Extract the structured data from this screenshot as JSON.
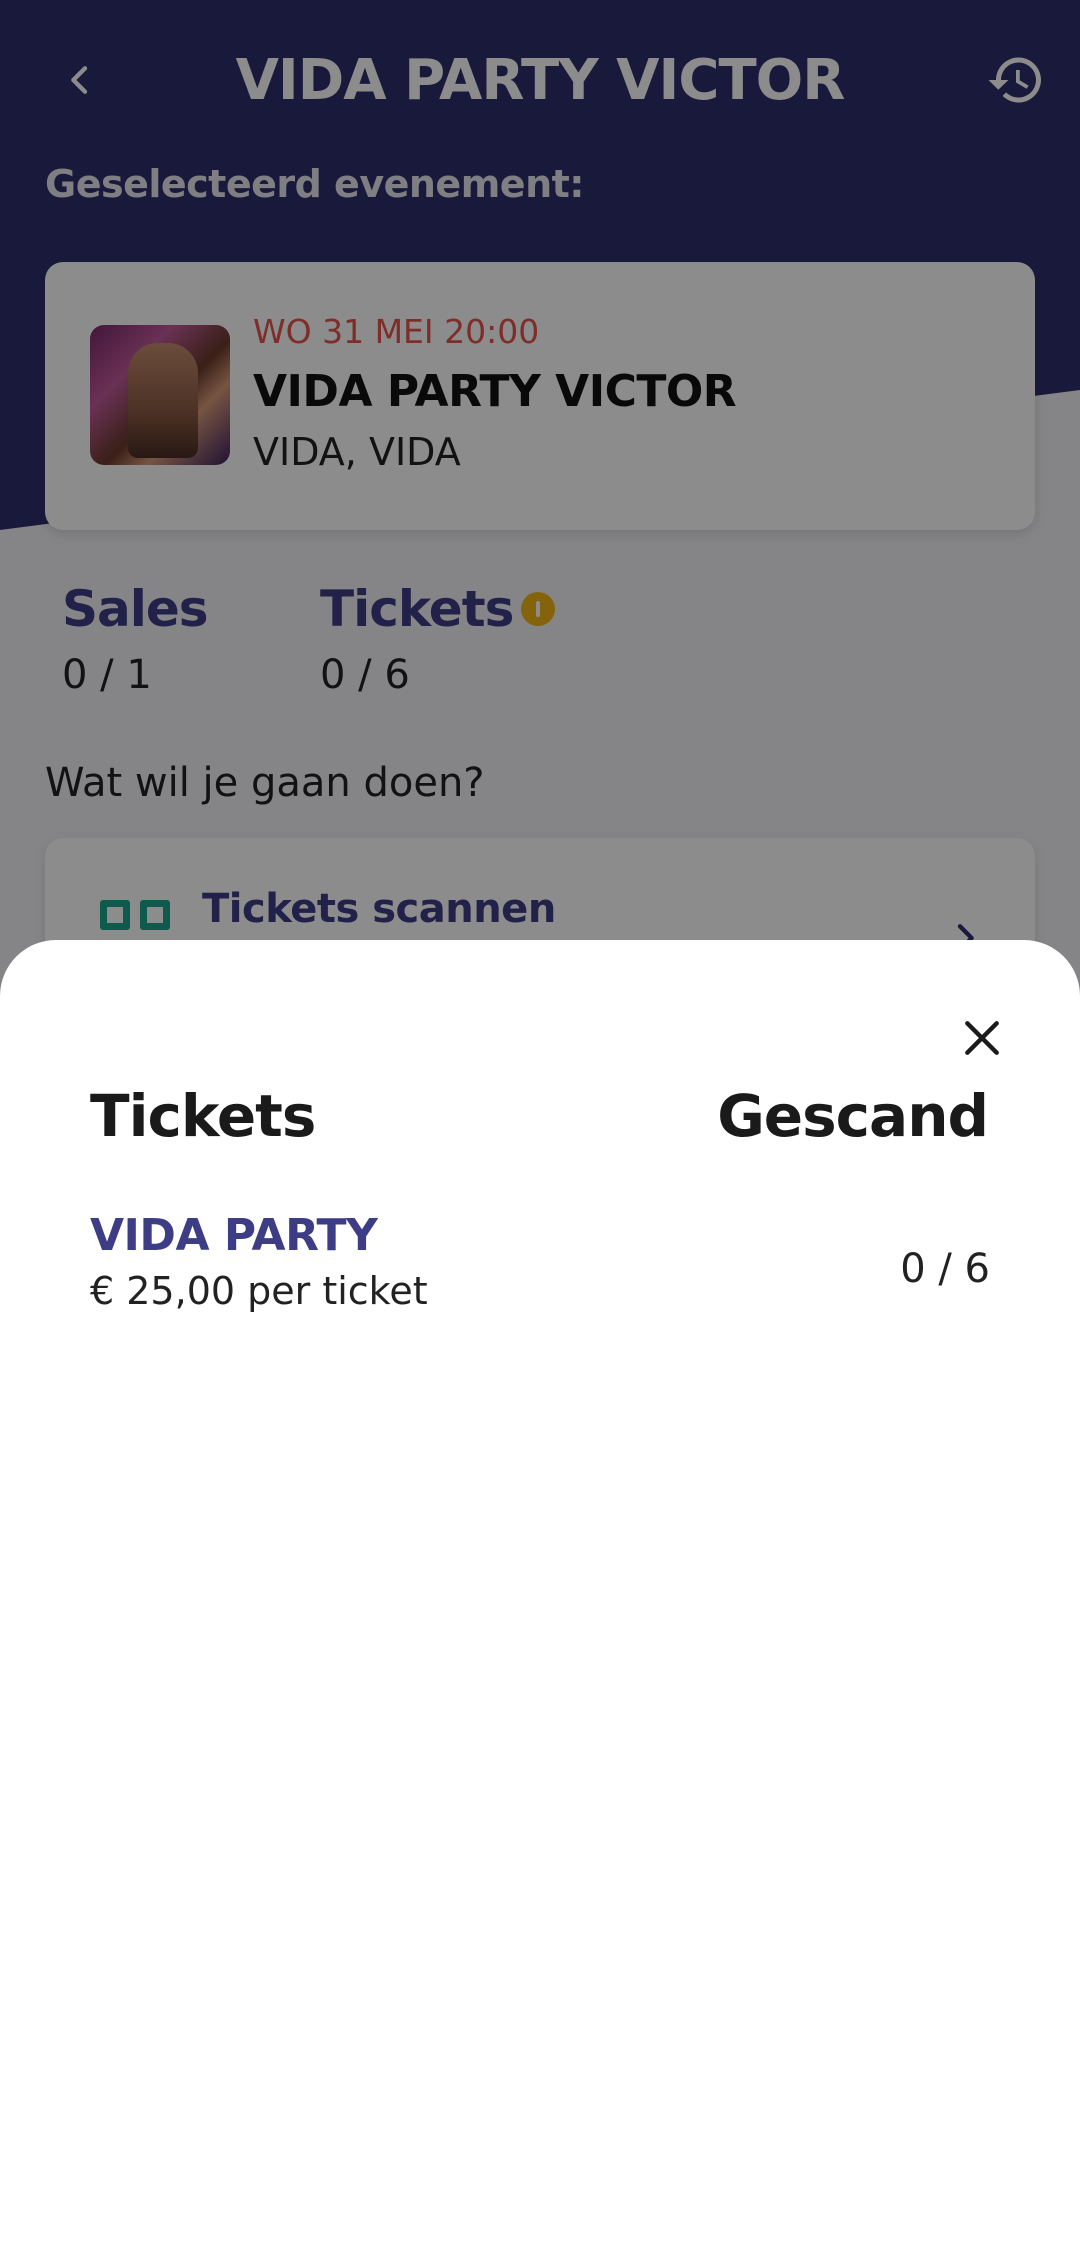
{
  "header": {
    "title": "VIDA PARTY VICTOR",
    "back_icon": "chevron-left-icon",
    "history_icon": "history-icon",
    "selected_label": "Geselecteerd evenement:"
  },
  "event": {
    "date": "WO 31 MEI 20:00",
    "name": "VIDA PARTY VICTOR",
    "venue": "VIDA, VIDA"
  },
  "stats": {
    "sales": {
      "label": "Sales",
      "value": "0 / 1"
    },
    "tickets": {
      "label": "Tickets",
      "value": "0 / 6",
      "info_icon": "info-icon"
    }
  },
  "question": "Wat wil je gaan doen?",
  "actions": [
    {
      "label": "Tickets scannen",
      "icon": "qr-scan-icon"
    }
  ],
  "sheet": {
    "col_tickets": "Tickets",
    "col_scanned": "Gescand",
    "close_icon": "close-icon",
    "rows": [
      {
        "name": "VIDA PARTY",
        "price": "€ 25,00 per ticket",
        "scanned": "0 / 6"
      }
    ]
  },
  "colors": {
    "header_bg": "#2f2f6e",
    "accent": "#3d3d85",
    "date_red": "#e5534b",
    "info_yellow": "#f2b418",
    "scan_green": "#1aa58a"
  }
}
